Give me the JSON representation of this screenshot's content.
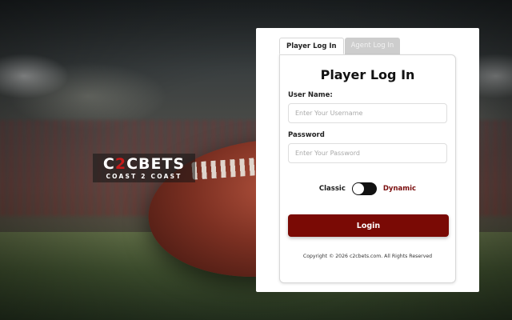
{
  "brand": {
    "logo_prefix": "C",
    "logo_accent": "2",
    "logo_suffix": "CBETS",
    "logo_tagline": "COAST 2 COAST",
    "accent_color": "#c61b1b"
  },
  "tabs": [
    {
      "label": "Player Log In",
      "active": true
    },
    {
      "label": "Agent Log In",
      "active": false
    }
  ],
  "form": {
    "title": "Player Log In",
    "username_label": "User Name:",
    "username_placeholder": "Enter Your Username",
    "username_value": "",
    "password_label": "Password",
    "password_placeholder": "Enter Your Password",
    "password_value": ""
  },
  "mode_toggle": {
    "left_label": "Classic",
    "right_label": "Dynamic",
    "state": "Classic"
  },
  "login_button": {
    "label": "Login",
    "color": "#7a0a05"
  },
  "footer": {
    "copyright": "Copyright © 2026 c2cbets.com. All Rights Reserved"
  }
}
